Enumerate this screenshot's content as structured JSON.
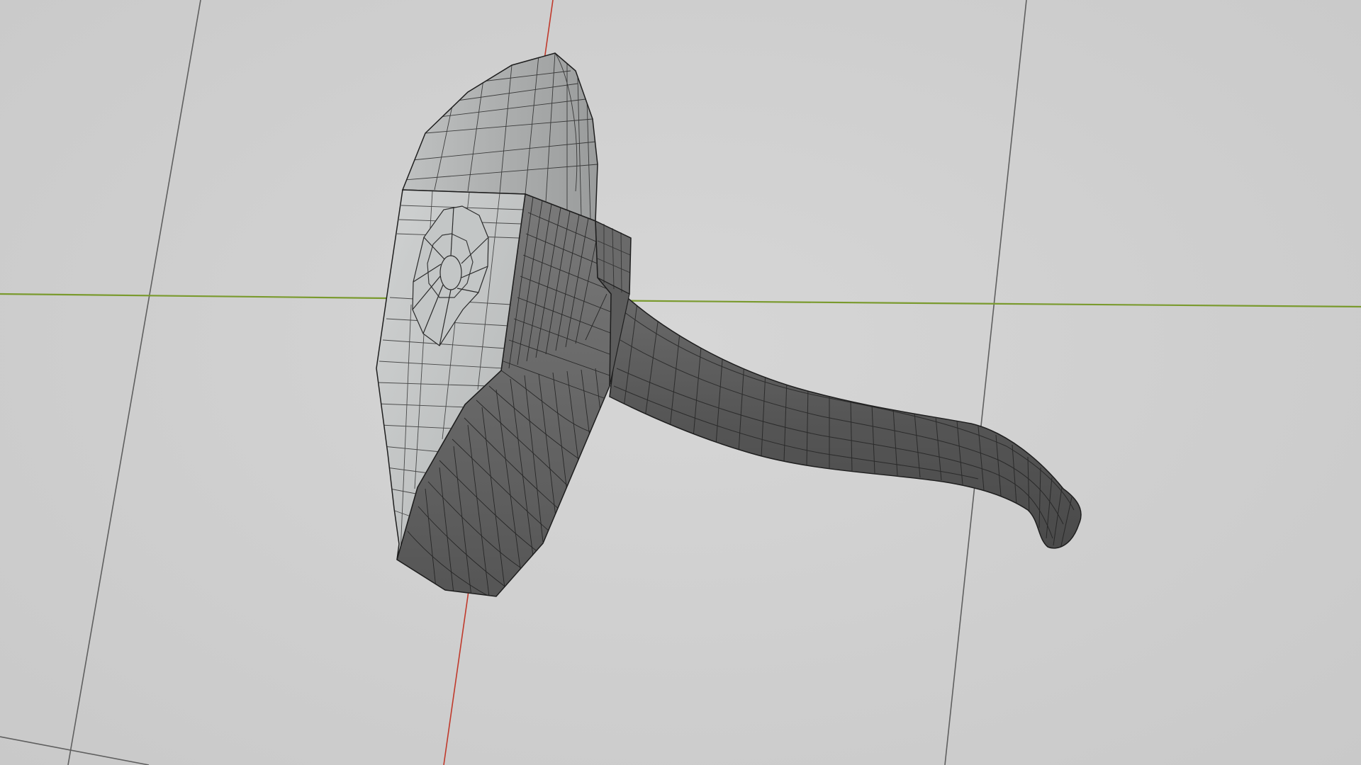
{
  "viewport": {
    "background_color": "#cfcfcf",
    "grid_color": "#5f5f5f",
    "x_axis_color": "#c0392b",
    "y_axis_color": "#7a9a2e",
    "object_color": "#5a5a5a",
    "object_light_face_color": "#c8cbcb",
    "wireframe_color": "#1e1e1e"
  },
  "object": {
    "icon": "hammer-mesh",
    "parts": [
      "head",
      "face",
      "handle"
    ]
  }
}
